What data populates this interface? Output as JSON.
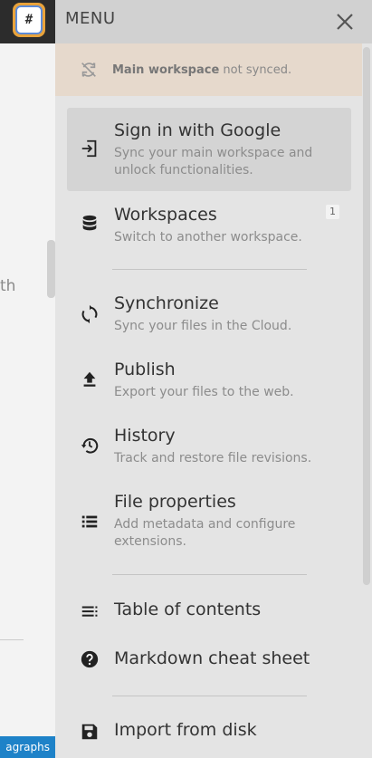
{
  "backdrop": {
    "logo_glyph": "#",
    "peek_text": "th",
    "peek_tag": "agraphs"
  },
  "menu": {
    "title": "MENU",
    "close_icon": "close-icon",
    "sync_notice": {
      "workspace": "Main workspace",
      "status": " not synced."
    },
    "items": [
      {
        "title": "Sign in with Google",
        "desc": "Sync your main workspace and unlock functionalities.",
        "icon": "sign-in-icon"
      },
      {
        "title": "Workspaces",
        "desc": "Switch to another workspace.",
        "icon": "database-icon",
        "badge": "1"
      },
      {
        "title": "Synchronize",
        "desc": "Sync your files in the Cloud.",
        "icon": "sync-icon"
      },
      {
        "title": "Publish",
        "desc": "Export your files to the web.",
        "icon": "upload-icon"
      },
      {
        "title": "History",
        "desc": "Track and restore file revisions.",
        "icon": "history-icon"
      },
      {
        "title": "File properties",
        "desc": "Add metadata and configure extensions.",
        "icon": "list-icon"
      },
      {
        "title": "Table of contents",
        "icon": "toc-icon"
      },
      {
        "title": "Markdown cheat sheet",
        "icon": "help-icon"
      },
      {
        "title": "Import from disk",
        "icon": "save-icon"
      }
    ]
  },
  "colors": {
    "panel_bg": "#e4e4e4",
    "header_bg": "#d1d1d1",
    "notice_bg": "#e6d9cc",
    "accent_tag": "#1e82c8"
  }
}
